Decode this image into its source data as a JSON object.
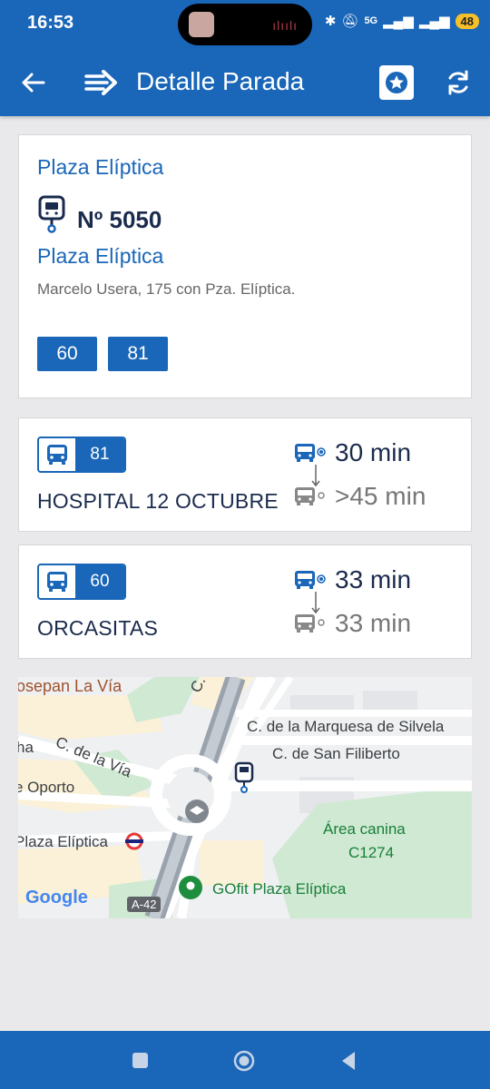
{
  "status_bar": {
    "time": "16:53",
    "network": "5G",
    "battery": "48"
  },
  "app_bar": {
    "title": "Detalle Parada"
  },
  "stop": {
    "name_top": "Plaza Elíptica",
    "number": "Nº 5050",
    "name": "Plaza Elíptica",
    "address": "Marcelo Usera, 175 con Pza. Elíptica.",
    "lines": [
      "60",
      "81"
    ]
  },
  "arrivals": [
    {
      "line": "81",
      "destination": "HOSPITAL 12 OCTUBRE",
      "next": "30 min",
      "following": ">45 min"
    },
    {
      "line": "60",
      "destination": "ORCASITAS",
      "next": "33 min",
      "following": "33 min"
    }
  ],
  "map": {
    "labels": {
      "josepan": "osepan La Vía",
      "c_de_top": "C. de",
      "marquesa": "C. de la Marquesa de Silvela",
      "filiberto": "C. de San Filiberto",
      "via": "C. de la Vía",
      "ha": "ha",
      "oporto": "e Oporto",
      "plaza_eliptica": "Plaza Elíptica",
      "area_canina": "Área canina",
      "c1274": "C1274",
      "gofit": "GOfit Plaza Elíptica",
      "google": "Google",
      "a42": "A-42"
    }
  },
  "colors": {
    "primary": "#1a66b8",
    "dark_text": "#1b2b4d",
    "grey_text": "#777777",
    "background": "#e9e9eb"
  }
}
